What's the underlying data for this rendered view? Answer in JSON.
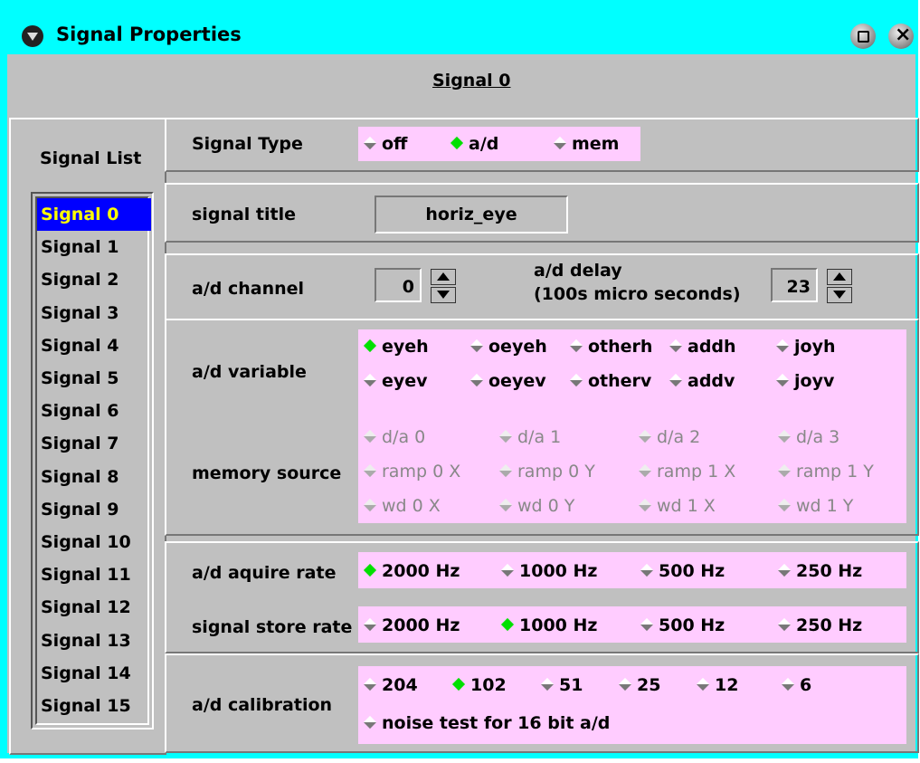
{
  "window": {
    "title": "Signal Properties"
  },
  "header": {
    "signal_name": "Signal 0"
  },
  "signal_list": {
    "title": "Signal List",
    "items": [
      "Signal 0",
      "Signal 1",
      "Signal 2",
      "Signal 3",
      "Signal 4",
      "Signal 5",
      "Signal 6",
      "Signal 7",
      "Signal 8",
      "Signal 9",
      "Signal 10",
      "Signal 11",
      "Signal 12",
      "Signal 13",
      "Signal 14",
      "Signal 15"
    ],
    "selected": "Signal 0"
  },
  "signal_type": {
    "label": "Signal Type",
    "options": [
      "off",
      "a/d",
      "mem"
    ],
    "selected": "a/d"
  },
  "signal_title": {
    "label": "signal title",
    "value": "horiz_eye"
  },
  "ad_channel": {
    "label": "a/d channel",
    "value": "0"
  },
  "ad_delay": {
    "label_line1": "a/d delay",
    "label_line2": "(100s micro seconds)",
    "value": "23"
  },
  "ad_variable": {
    "label": "a/d variable",
    "row1": [
      "eyeh",
      "oeyeh",
      "otherh",
      "addh",
      "joyh"
    ],
    "row2": [
      "eyev",
      "oeyev",
      "otherv",
      "addv",
      "joyv"
    ],
    "selected": "eyeh"
  },
  "memory_source": {
    "label": "memory source",
    "row1": [
      "d/a 0",
      "d/a 1",
      "d/a 2",
      "d/a 3"
    ],
    "row2": [
      "ramp 0 X",
      "ramp 0 Y",
      "ramp 1 X",
      "ramp 1 Y"
    ],
    "row3": [
      "wd 0 X",
      "wd 0 Y",
      "wd 1 X",
      "wd 1 Y"
    ]
  },
  "aquire_rate": {
    "label": "a/d aquire rate",
    "options": [
      "2000 Hz",
      "1000 Hz",
      "500 Hz",
      "250 Hz"
    ],
    "selected": "2000 Hz"
  },
  "store_rate": {
    "label": "signal store rate",
    "options": [
      "2000 Hz",
      "1000 Hz",
      "500 Hz",
      "250 Hz"
    ],
    "selected": "1000 Hz"
  },
  "calibration": {
    "label": "a/d calibration",
    "options": [
      "204",
      "102",
      "51",
      "25",
      "12",
      "6"
    ],
    "selected": "102",
    "noise_test": "noise test for 16 bit a/d"
  },
  "colors": {
    "titlebar": "#00ffff",
    "panel": "#c0c0c0",
    "option_bg": "#ffccff",
    "selected_dot": "#00e000",
    "list_selection": "#0000ff"
  }
}
